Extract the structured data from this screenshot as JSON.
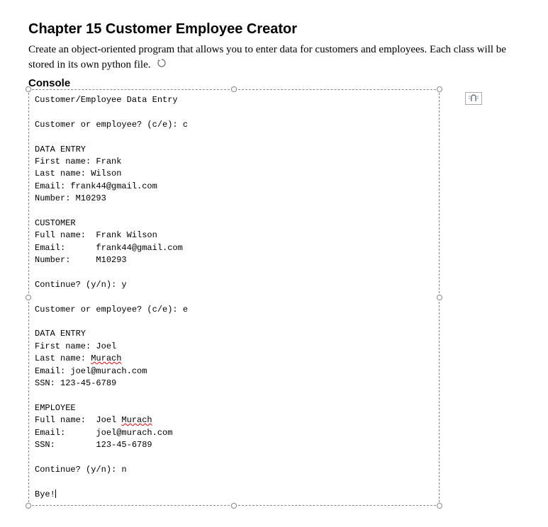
{
  "title": "Chapter 15 Customer Employee Creator",
  "description": "Create an object-oriented program that allows you to enter data for customers and employees. Each class will be stored in its own python file.",
  "console_label": "Console",
  "console": {
    "header": "Customer/Employee Data Entry",
    "blank1": "",
    "prompt1": "Customer or employee? (c/e): c",
    "blank2": "",
    "de1": "DATA ENTRY",
    "de1_fn": "First name: Frank",
    "de1_ln": "Last name: Wilson",
    "de1_em": "Email: frank44@gmail.com",
    "de1_num": "Number: M10293",
    "blank3": "",
    "cust_h": "CUSTOMER",
    "cust_fn": "Full name:  Frank Wilson",
    "cust_em": "Email:      frank44@gmail.com",
    "cust_num": "Number:     M10293",
    "blank4": "",
    "cont1": "Continue? (y/n): y",
    "blank5": "",
    "prompt2": "Customer or employee? (c/e): e",
    "blank6": "",
    "de2": "DATA ENTRY",
    "de2_fn": "First name: Joel",
    "de2_ln_pre": "Last name: ",
    "de2_ln_sq": "Murach",
    "de2_em": "Email: joel@murach.com",
    "de2_ssn": "SSN: 123-45-6789",
    "blank7": "",
    "emp_h": "EMPLOYEE",
    "emp_fn_pre": "Full name:  Joel ",
    "emp_fn_sq": "Murach",
    "emp_em": "Email:      joel@murach.com",
    "emp_ssn": "SSN:        123-45-6789",
    "blank8": "",
    "cont2": "Continue? (y/n): n",
    "blank9": "",
    "bye": "Bye!"
  }
}
